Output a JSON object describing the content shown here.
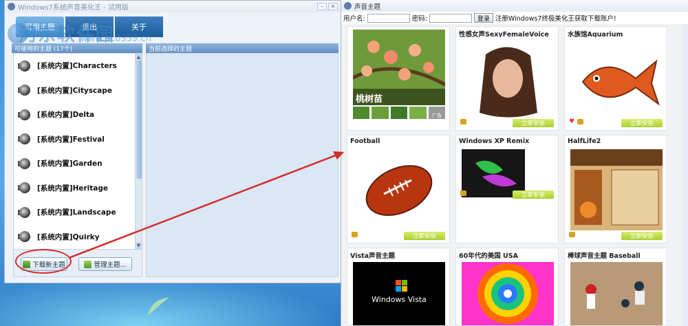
{
  "left_window": {
    "title": "Windows7系统声音美化王 - 试用版",
    "tabs": [
      "可用主题",
      "退出",
      "关于"
    ],
    "watermark": "河东软件园",
    "watermark_url": "www.pc0359.cn",
    "available_header": "可使用的主题 (17个)",
    "selected_header": "当前选择的主题",
    "themes": [
      "[系统内置]Characters",
      "[系统内置]Cityscape",
      "[系统内置]Delta",
      "[系统内置]Festival",
      "[系统内置]Garden",
      "[系统内置]Heritage",
      "[系统内置]Landscape",
      "[系统内置]Quirky"
    ],
    "download_button": "下载新主题",
    "manage_button": "管理主题..."
  },
  "right_window": {
    "title": "声音主题",
    "login": {
      "username_label": "用户名:",
      "password_label": "密码:",
      "login_button": "登录",
      "register_text": "注册Windows7终极美化王获取下载账户!"
    },
    "install_label": "立即安装",
    "cards": [
      {
        "title": "",
        "caption": "桃树苗",
        "has_install": false
      },
      {
        "title": "性感女声SexyFemaleVoice",
        "has_install": true
      },
      {
        "title": "水族馆Aquarium",
        "has_install": true,
        "favorite": true
      },
      {
        "title": "Football",
        "has_install": true
      },
      {
        "title": "Windows XP Remix",
        "has_install": true
      },
      {
        "title": "HalfLife2",
        "has_install": true
      },
      {
        "title": "Vista声音主题",
        "thumb_text": "Windows Vista",
        "has_install": false
      },
      {
        "title": "60年代的美国 USA",
        "has_install": false
      },
      {
        "title": "棒球声音主题 Baseball",
        "has_install": false
      }
    ],
    "ad_label": "广告"
  },
  "colors": {
    "accent": "#3f86c8",
    "install": "#a9cf2c",
    "arrow": "#d42a2a"
  }
}
